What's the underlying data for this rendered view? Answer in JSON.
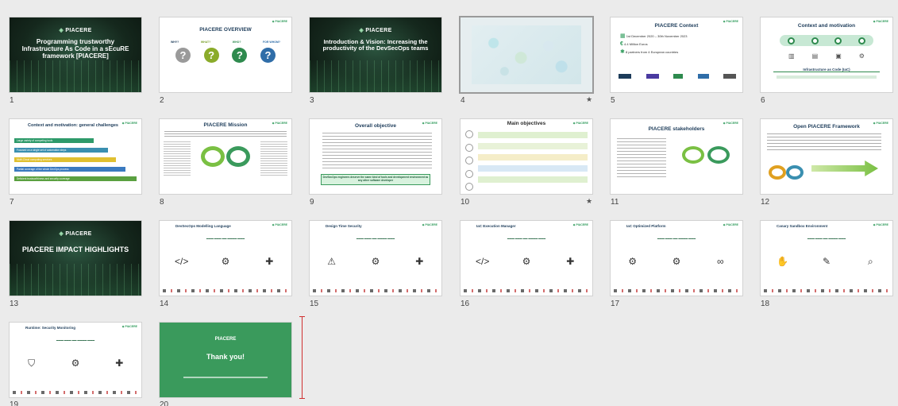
{
  "slides": [
    {
      "num": "1",
      "title": "Programming trustworthy Infrastructure As Code in a sEcuRE framework [PIACERE]",
      "logo": "PIACERE"
    },
    {
      "num": "2",
      "title": "PIACERE OVERVIEW",
      "labels": [
        "WHY?",
        "WHAT?",
        "WHO?",
        "FOR WHOM?"
      ]
    },
    {
      "num": "3",
      "title": "Introduction & Vision: Increasing the productivity of the DevSecOps teams",
      "logo": "PIACERE"
    },
    {
      "num": "4",
      "starred": "★"
    },
    {
      "num": "5",
      "title": "PIACERE Context",
      "lines": [
        "1st December 2020 – 30th November 2023",
        "4.4 Million Euros",
        "8 partners from 4 European countries"
      ]
    },
    {
      "num": "6",
      "title": "Context and motivation",
      "caption": "Infrastructure as Code (IaC)"
    },
    {
      "num": "7",
      "title": "Context and motivation: general challenges",
      "bars": [
        "Large variety of competing tools",
        "Focused on a single set of automation steps",
        "Multi-Cloud computing services",
        "Partial coverage of the whole DevOps process",
        "Deficient trustworthiness and security coverage"
      ]
    },
    {
      "num": "8",
      "title": "PIACERE Mission"
    },
    {
      "num": "9",
      "title": "Overall objective",
      "caption": "DevSecOps engineers deserve the same kind of tools and development environment as any other software developer"
    },
    {
      "num": "10",
      "title": "Main objectives",
      "starred": "★"
    },
    {
      "num": "11",
      "title": "PIACERE stakeholders"
    },
    {
      "num": "12",
      "title": "Open PIACERE Framework"
    },
    {
      "num": "13",
      "title": "PIACERE IMPACT HIGHLIGHTS",
      "logo": "PIACERE"
    },
    {
      "num": "14",
      "title": "DevSecOps Modelling Language"
    },
    {
      "num": "15",
      "title": "Design Time Security"
    },
    {
      "num": "16",
      "title": "IaC Execution Manager"
    },
    {
      "num": "17",
      "title": "IaC Optimized Platform"
    },
    {
      "num": "18",
      "title": "Canary Sandbox Environment"
    },
    {
      "num": "19",
      "title": "Runtime: Security Monitoring"
    },
    {
      "num": "20",
      "title": "Thank you!",
      "logo": "PIACERE"
    }
  ]
}
